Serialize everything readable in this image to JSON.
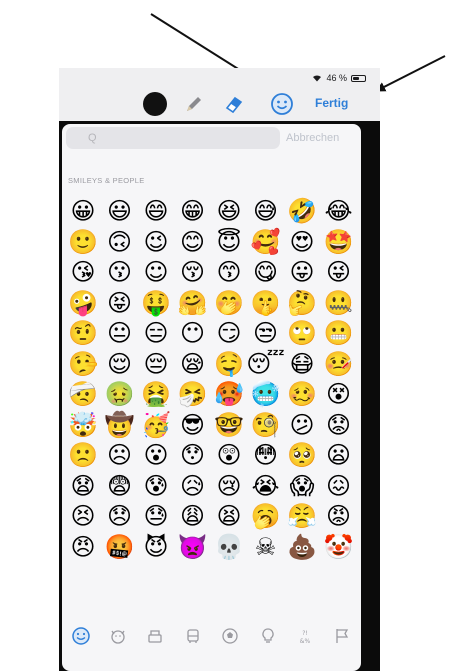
{
  "status": {
    "wifi_icon": "wifi-icon",
    "battery_text": "46 %",
    "battery_level": 0.46
  },
  "toolbar": {
    "tools": [
      "color-dot",
      "pencil-icon",
      "eraser-icon",
      "smiley-icon"
    ],
    "done_label": "Fertig",
    "accent_color": "#2f7fd8"
  },
  "emoji_picker": {
    "search_placeholder": "Q",
    "cancel_label": "Abbrechen",
    "section_title": "SMILEYS & PEOPLE",
    "emojis": [
      "😀",
      "😃",
      "😄",
      "😁",
      "😆",
      "😅",
      "🤣",
      "😂",
      "🙂",
      "🙃",
      "😉",
      "😊",
      "😇",
      "🥰",
      "😍",
      "🤩",
      "😘",
      "😗",
      "☺",
      "😚",
      "😙",
      "😋",
      "😛",
      "😜",
      "🤪",
      "😝",
      "🤑",
      "🤗",
      "🤭",
      "🤫",
      "🤔",
      "🤐",
      "🤨",
      "😐",
      "😑",
      "😶",
      "😏",
      "😒",
      "🙄",
      "😬",
      "🤥",
      "😌",
      "😔",
      "😪",
      "🤤",
      "😴",
      "😷",
      "🤒",
      "🤕",
      "🤢",
      "🤮",
      "🤧",
      "🥵",
      "🥶",
      "🥴",
      "😵",
      "🤯",
      "🤠",
      "🥳",
      "😎",
      "🤓",
      "🧐",
      "😕",
      "😟",
      "🙁",
      "☹",
      "😮",
      "😯",
      "😲",
      "😳",
      "🥺",
      "😦",
      "😧",
      "😨",
      "😰",
      "😥",
      "😢",
      "😭",
      "😱",
      "😖",
      "😣",
      "😞",
      "😓",
      "😩",
      "😫",
      "🥱",
      "😤",
      "😡",
      "😠",
      "🤬",
      "😈",
      "👿",
      "💀",
      "☠",
      "💩",
      "🤡"
    ],
    "categories": [
      "smiley-icon",
      "animal-icon",
      "food-icon",
      "travel-icon",
      "activity-icon",
      "object-icon",
      "symbol-icon",
      "flag-icon"
    ],
    "symbol_category_label": "&%"
  }
}
